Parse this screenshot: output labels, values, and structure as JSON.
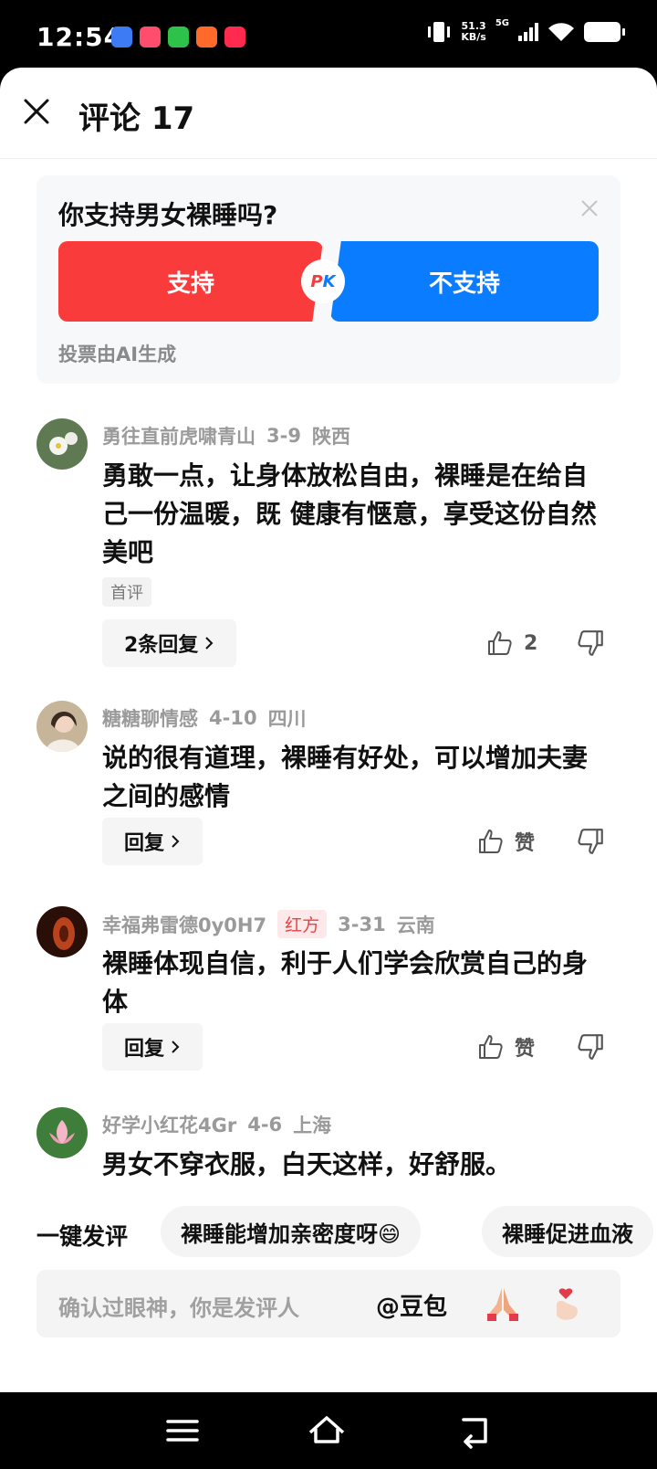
{
  "status": {
    "time": "12:54",
    "speed_value": "51.3",
    "speed_unit": "KB/s",
    "network": "5G"
  },
  "header": {
    "title": "评论 17"
  },
  "poll": {
    "question": "你支持男女裸睡吗?",
    "option_yes": "支持",
    "option_no": "不支持",
    "pk": "PK",
    "note": "投票由AI生成"
  },
  "comments": [
    {
      "user": "勇往直前虎啸青山",
      "date": "3-9",
      "location": "陕西",
      "text": "勇敢一点，让身体放松自由，裸睡是在给自己一份温暖，既 健康有惬意，享受这份自然美吧",
      "tag": "首评",
      "reply_label": "2条回复",
      "likes": "2"
    },
    {
      "user": "糖糖聊情感",
      "date": "4-10",
      "location": "四川",
      "text": "说的很有道理，裸睡有好处，可以增加夫妻之间的感情",
      "reply_label": "回复",
      "likes": "赞"
    },
    {
      "user": "幸福弗雷德0y0H7",
      "badge": "红方",
      "date": "3-31",
      "location": "云南",
      "text": "裸睡体现自信，利于人们学会欣赏自己的身体",
      "reply_label": "回复",
      "likes": "赞"
    },
    {
      "user": "好学小红花4Gr",
      "date": "4-6",
      "location": "上海",
      "text": "男女不穿衣服，白天这样，好舒服。"
    }
  ],
  "quick": {
    "label": "一键发评",
    "chips": [
      "裸睡能增加亲密度呀😄",
      "裸睡促进血液"
    ]
  },
  "input": {
    "placeholder": "确认过眼神，你是发评人",
    "mention": "@豆包"
  }
}
